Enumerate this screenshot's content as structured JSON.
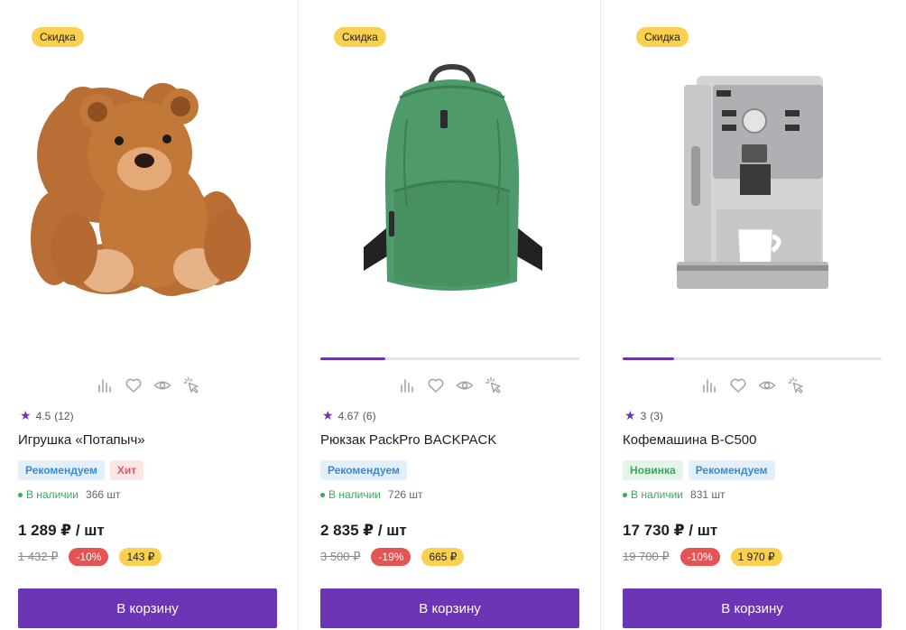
{
  "products": [
    {
      "badge": "Скидка",
      "image": "teddy-bear",
      "progress": null,
      "rating": "4.5",
      "reviews": "(12)",
      "title": "Игрушка «Потапыч»",
      "tags": [
        {
          "label": "Рекомендуем",
          "color": "blue"
        },
        {
          "label": "Хит",
          "color": "red"
        }
      ],
      "stock_label": "В наличии",
      "stock_qty": "366 шт",
      "price": "1 289 ₽ / шт",
      "old_price": "1 432 ₽",
      "discount_pct": "-10%",
      "savings": "143 ₽",
      "cart_label": "В корзину"
    },
    {
      "badge": "Скидка",
      "image": "backpack",
      "progress": 0.25,
      "rating": "4.67",
      "reviews": "(6)",
      "title": "Рюкзак PackPro BACKPACK",
      "tags": [
        {
          "label": "Рекомендуем",
          "color": "blue"
        }
      ],
      "stock_label": "В наличии",
      "stock_qty": "726 шт",
      "price": "2 835 ₽ / шт",
      "old_price": "3 500 ₽",
      "discount_pct": "-19%",
      "savings": "665 ₽",
      "cart_label": "В корзину"
    },
    {
      "badge": "Скидка",
      "image": "coffee-machine",
      "progress": 0.2,
      "rating": "3",
      "reviews": "(3)",
      "title": "Кофемашина B-C500",
      "tags": [
        {
          "label": "Новинка",
          "color": "green"
        },
        {
          "label": "Рекомендуем",
          "color": "blue"
        }
      ],
      "stock_label": "В наличии",
      "stock_qty": "831 шт",
      "price": "17 730 ₽ / шт",
      "old_price": "19 700 ₽",
      "discount_pct": "-10%",
      "savings": "1 970 ₽",
      "cart_label": "В корзину"
    }
  ],
  "colors": {
    "accent": "#6c35b6",
    "badge_yellow": "#fbd04f",
    "discount_red": "#e55353",
    "in_stock_green": "#3aa85f"
  },
  "icons": [
    "compare-icon",
    "heart-icon",
    "eye-icon",
    "quick-view-icon",
    "star-icon"
  ]
}
